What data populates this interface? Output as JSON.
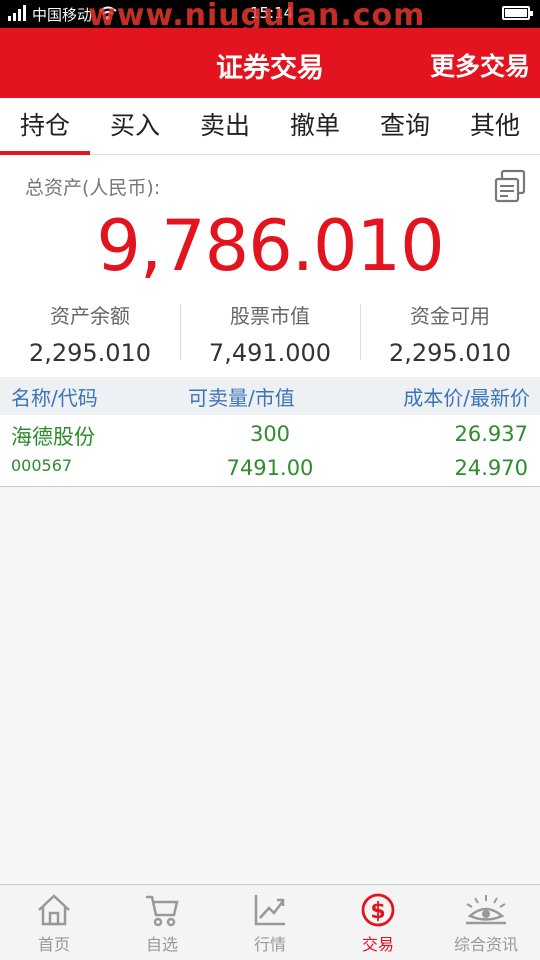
{
  "status_bar": {
    "carrier": "中国移动",
    "time": "15:14",
    "watermark": "www.niugulan.com"
  },
  "header": {
    "title": "证券交易",
    "more": "更多交易"
  },
  "tabs": [
    {
      "label": "持仓",
      "active": true
    },
    {
      "label": "买入",
      "active": false
    },
    {
      "label": "卖出",
      "active": false
    },
    {
      "label": "撤单",
      "active": false
    },
    {
      "label": "查询",
      "active": false
    },
    {
      "label": "其他",
      "active": false
    }
  ],
  "summary": {
    "total_label": "总资产(人民币):",
    "total_value": "9,786.010",
    "stats": [
      {
        "label": "资产余额",
        "value": "2,295.010"
      },
      {
        "label": "股票市值",
        "value": "7,491.000"
      },
      {
        "label": "资金可用",
        "value": "2,295.010"
      }
    ]
  },
  "holdings": {
    "headers": {
      "name_code": "名称/代码",
      "qty_value": "可卖量/市值",
      "cost_price": "成本价/最新价"
    },
    "rows": [
      {
        "name": "海德股份",
        "code": "000567",
        "sellable": "300",
        "market_value": "7491.00",
        "cost": "26.937",
        "latest": "24.970"
      }
    ]
  },
  "bottom_nav": [
    {
      "label": "首页",
      "icon": "home-icon",
      "active": false
    },
    {
      "label": "自选",
      "icon": "cart-icon",
      "active": false
    },
    {
      "label": "行情",
      "icon": "chart-icon",
      "active": false
    },
    {
      "label": "交易",
      "icon": "dollar-icon",
      "active": true
    },
    {
      "label": "综合资讯",
      "icon": "eye-icon",
      "active": false
    }
  ],
  "colors": {
    "brand_red": "#e3141f",
    "up_green": "#2e8b2e",
    "header_blue": "#3d74b6"
  }
}
